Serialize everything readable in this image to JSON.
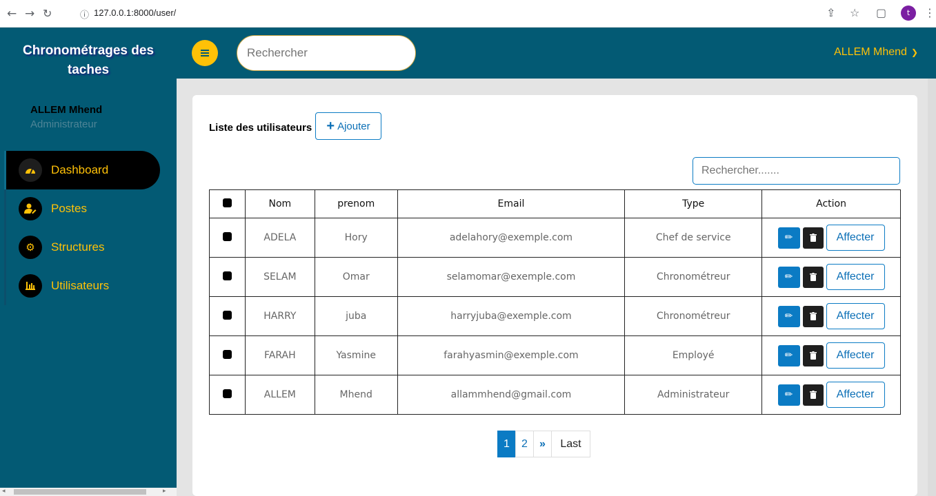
{
  "browser": {
    "url": "127.0.0.1:8000/user/",
    "profile_initial": "t"
  },
  "sidebar": {
    "brand": "Chronométrages des taches",
    "user_name": "ALLEM Mhend",
    "user_role": "Administrateur",
    "items": [
      {
        "label": "Dashboard",
        "icon": "gauge-icon",
        "active": true
      },
      {
        "label": "Postes",
        "icon": "user-edit-icon",
        "active": false
      },
      {
        "label": "Structures",
        "icon": "cog-icon",
        "active": false
      },
      {
        "label": "Utilisateurs",
        "icon": "bar-chart-icon",
        "active": false
      }
    ]
  },
  "topbar": {
    "search_placeholder": "Rechercher",
    "user": "ALLEM Mhend"
  },
  "content": {
    "title": "Liste des utilisateurs",
    "add_label": "Ajouter",
    "search_placeholder": "Rechercher.......",
    "columns": [
      "Nom",
      "prenom",
      "Email",
      "Type",
      "Action"
    ],
    "rows": [
      {
        "nom": "ADELA",
        "prenom": "Hory",
        "email": "adelahory@exemple.com",
        "type": "Chef de service",
        "assign": "Affecter"
      },
      {
        "nom": "SELAM",
        "prenom": "Omar",
        "email": "selamomar@exemple.com",
        "type": "Chronométreur",
        "assign": "Affecter"
      },
      {
        "nom": "HARRY",
        "prenom": "juba",
        "email": "harryjuba@exemple.com",
        "type": "Chronométreur",
        "assign": "Affecter"
      },
      {
        "nom": "FARAH",
        "prenom": "Yasmine",
        "email": "farahyasmin@exemple.com",
        "type": "Employé",
        "assign": "Affecter"
      },
      {
        "nom": "ALLEM",
        "prenom": "Mhend",
        "email": "allammhend@gmail.com",
        "type": "Administrateur",
        "assign": "Affecter"
      }
    ],
    "pagination": {
      "pages": [
        "1",
        "2"
      ],
      "next": "»",
      "last": "Last",
      "current": "1"
    }
  },
  "colors": {
    "primary": "#035a74",
    "accent": "#ffc107",
    "button_blue": "#0b7bc4"
  }
}
